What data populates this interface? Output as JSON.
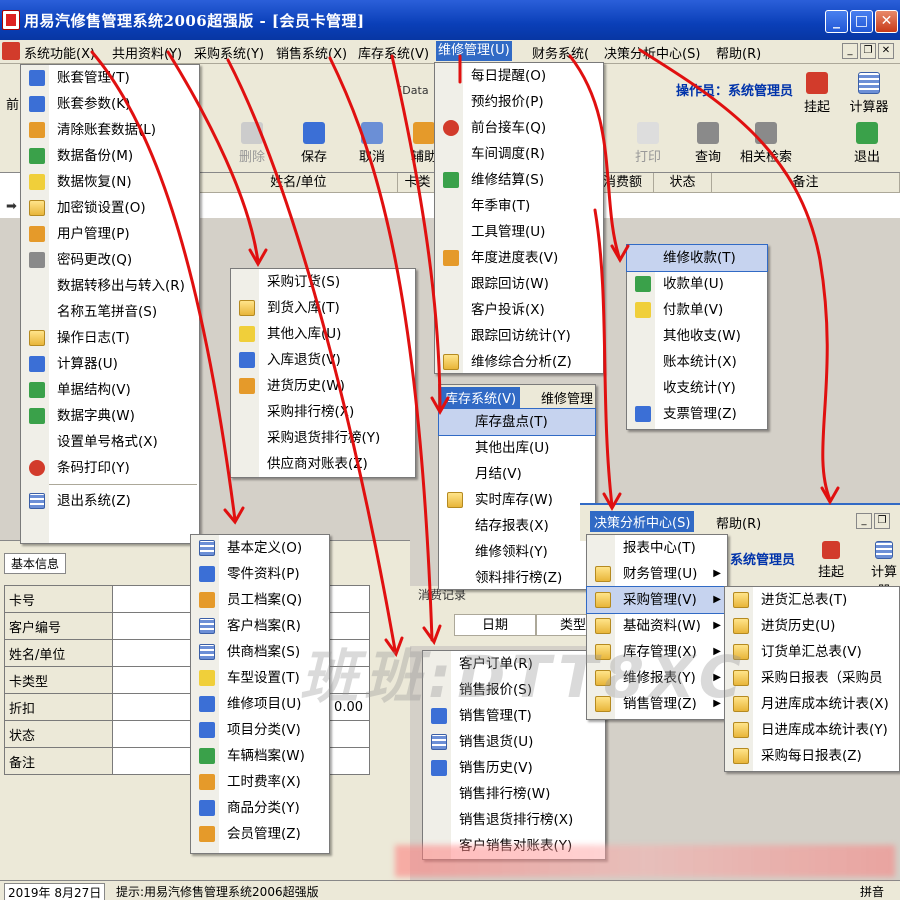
{
  "window": {
    "title": "用易汽修售管理系统2006超强版 - [会员卡管理]",
    "min_label": "_",
    "max_label": "□",
    "close_label": "✕"
  },
  "menubar": {
    "items": [
      "系统功能(X)",
      "共用资料(Y)",
      "采购系统(Y)",
      "销售系统(X)",
      "库存系统(V)",
      "维修管理(U)",
      "财务系统(",
      "决策分析中心(S)",
      "帮助(R)"
    ],
    "active_index": 5
  },
  "toolbar": {
    "operator": "操作员：系统管理员",
    "data_field": "[Data",
    "buttons": [
      "删除",
      "保存",
      "取消",
      "辅助",
      "打印",
      "查询",
      "相关检索",
      "退出",
      "挂起",
      "计算器"
    ],
    "left_label": "前"
  },
  "grid": {
    "headers": [
      "姓名/单位",
      "卡类",
      "消费额",
      "状态",
      "备注"
    ]
  },
  "system_menu": {
    "items": [
      "账套管理(T)",
      "账套参数(K)",
      "清除账套数据(L)",
      "数据备份(M)",
      "数据恢复(N)",
      "加密锁设置(O)",
      "用户管理(P)",
      "密码更改(Q)",
      "数据转移出与转入(R)",
      "名称五笔拼音(S)",
      "操作日志(T)",
      "计算器(U)",
      "单据结构(V)",
      "数据字典(W)",
      "设置单号格式(X)",
      "条码打印(Y)",
      "退出系统(Z)"
    ]
  },
  "purchase_menu": {
    "items": [
      "采购订货(S)",
      "到货入库(T)",
      "其他入库(U)",
      "入库退货(V)",
      "进货历史(W)",
      "采购排行榜(X)",
      "采购退货排行榜(Y)",
      "供应商对账表(Z)"
    ]
  },
  "repair_menu": {
    "items": [
      "每日提醒(O)",
      "预约报价(P)",
      "前台接车(Q)",
      "车间调度(R)",
      "维修结算(S)",
      "年季审(T)",
      "工具管理(U)",
      "年度进度表(V)",
      "跟踪回访(W)",
      "客户投诉(X)",
      "跟踪回访统计(Y)",
      "维修综合分析(Z)"
    ]
  },
  "inventory_menu": {
    "bar": [
      "库存系统(V)",
      "维修管理"
    ],
    "items": [
      "库存盘点(T)",
      "其他出库(U)",
      "月结(V)",
      "实时库存(W)",
      "结存报表(X)",
      "维修领料(Y)",
      "领料排行榜(Z)"
    ]
  },
  "finance_menu": {
    "items": [
      "维修收款(T)",
      "收款单(U)",
      "付款单(V)",
      "其他收支(W)",
      "账本统计(X)",
      "收支统计(Y)",
      "支票管理(Z)"
    ]
  },
  "shared_menu": {
    "items": [
      "基本定义(O)",
      "零件资料(P)",
      "员工档案(Q)",
      "客户档案(R)",
      "供商档案(S)",
      "车型设置(T)",
      "维修项目(U)",
      "项目分类(V)",
      "车辆档案(W)",
      "工时费率(X)",
      "商品分类(Y)",
      "会员管理(Z)"
    ]
  },
  "sales_menu": {
    "items": [
      "客户订单(R)",
      "销售报价(S)",
      "销售管理(T)",
      "销售退货(U)",
      "销售历史(V)",
      "销售排行榜(W)",
      "销售退货排行榜(X)",
      "客户销售对账表(Y)"
    ]
  },
  "decision_window": {
    "bar": [
      "决策分析中心(S)",
      "帮助(R)"
    ],
    "operator": "系统管理员",
    "buttons": [
      "挂起",
      "计算器"
    ],
    "menu_items": [
      "报表中心(T)",
      "财务管理(U)",
      "采购管理(V)",
      "基础资料(W)",
      "库存管理(X)",
      "维修报表(Y)",
      "销售管理(Z)"
    ],
    "submenu_items": [
      "进货汇总表(T)",
      "进货历史(U)",
      "订货单汇总表(V)",
      "采购日报表（采购员",
      "月进库成本统计表(X)",
      "日进库成本统计表(Y)",
      "采购每日报表(Z)"
    ]
  },
  "left_panel": {
    "tab": "基本信息",
    "fields": [
      "卡号",
      "客户编号",
      "姓名/单位",
      "卡类型",
      "折扣",
      "状态",
      "备注"
    ],
    "discount_value": "0.00"
  },
  "sales_record": {
    "caption": "消费记录",
    "headers": [
      "日期",
      "类型"
    ]
  },
  "statusbar": {
    "date": "2019年 8月27日",
    "hint": "提示:用易汽修售管理系统2006超强版",
    "right": "拼音"
  },
  "watermark": "班班:DTT8XC"
}
